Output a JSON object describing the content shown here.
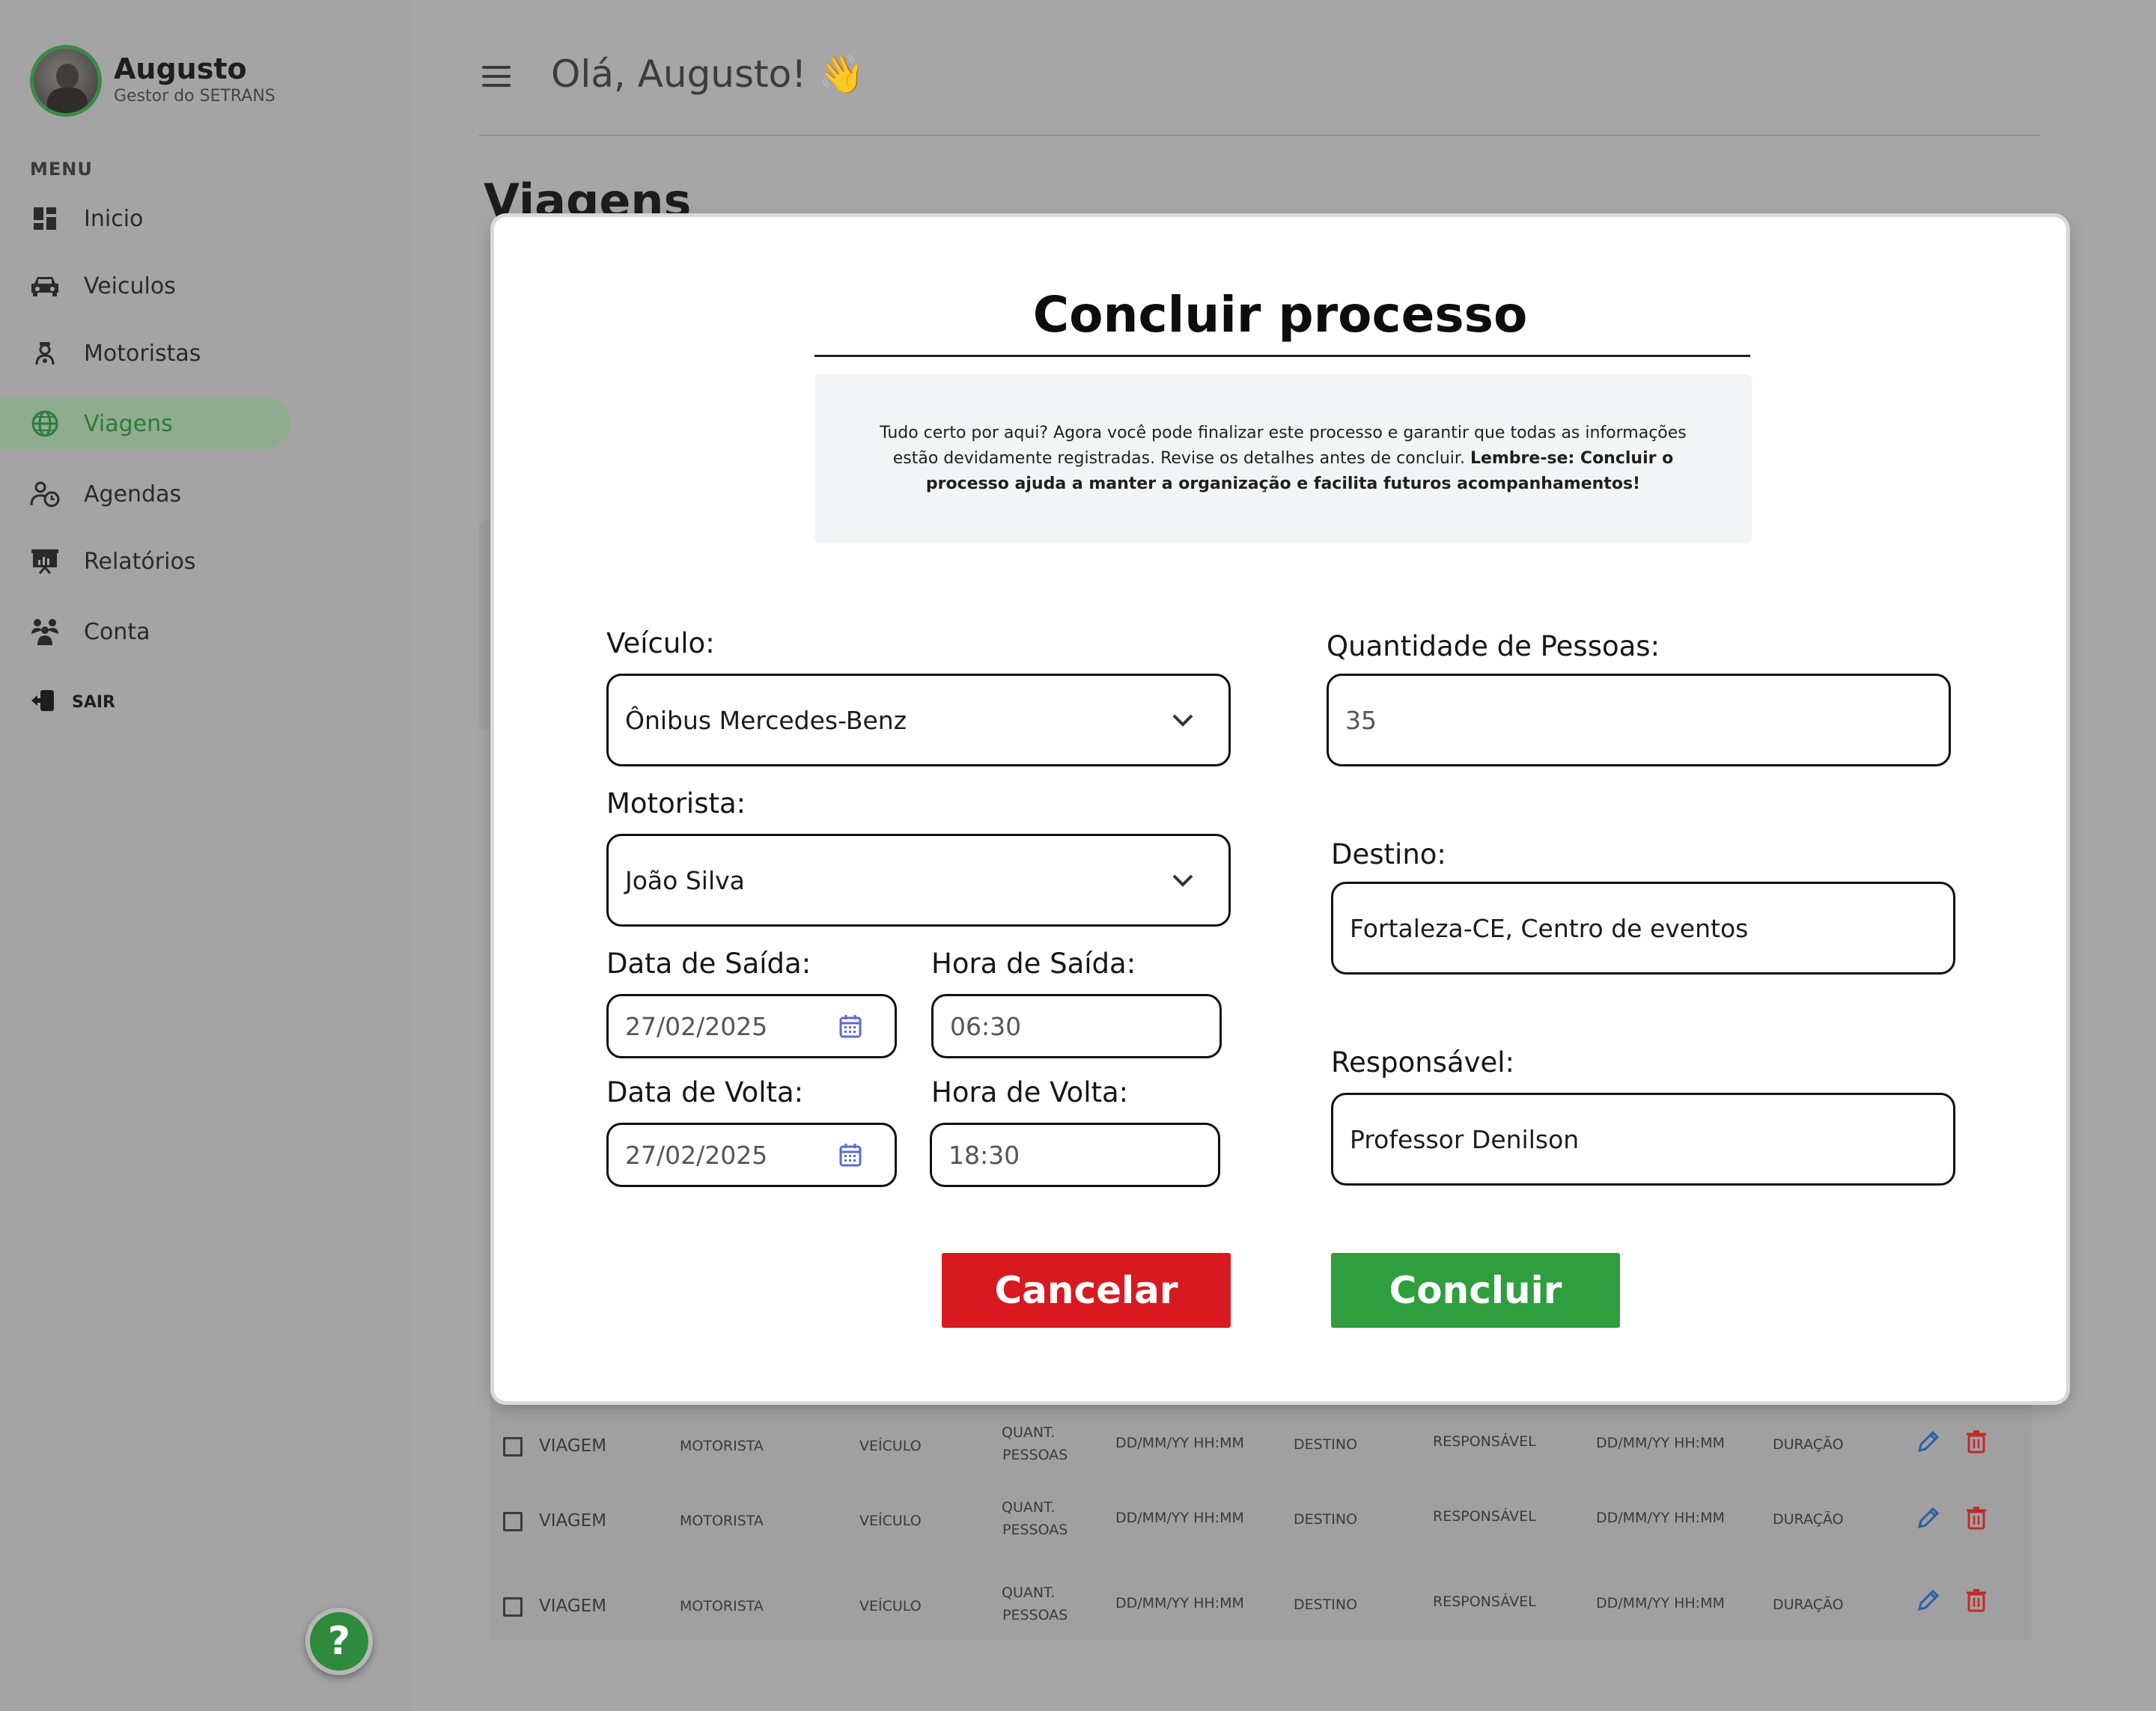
{
  "user": {
    "name": "Augusto",
    "role": "Gestor do SETRANS"
  },
  "sidebar": {
    "menu_label": "MENU",
    "items": [
      {
        "label": "Inicio",
        "icon": "dashboard-icon"
      },
      {
        "label": "Veiculos",
        "icon": "car-icon"
      },
      {
        "label": "Motoristas",
        "icon": "driver-icon"
      },
      {
        "label": "Viagens",
        "icon": "globe-icon",
        "active": true
      },
      {
        "label": "Agendas",
        "icon": "schedule-icon"
      },
      {
        "label": "Relatórios",
        "icon": "report-icon"
      },
      {
        "label": "Conta",
        "icon": "account-icon"
      }
    ],
    "exit_label": "SAIR",
    "help_label": "?"
  },
  "header": {
    "greeting": "Olá, Augusto! 👋"
  },
  "page": {
    "title": "Viagens"
  },
  "table": {
    "rows": [
      {
        "viagem": "VIAGEM",
        "motorista": "MOTORISTA",
        "veiculo": "VEÍCULO",
        "quant": "QUANT.",
        "pessoas": "PESSOAS",
        "saida": "DD/MM/YY HH:MM",
        "destino": "DESTINO",
        "responsavel": "RESPONSÁVEL",
        "volta": "DD/MM/YY HH:MM",
        "duracao": "DURAÇÃO"
      },
      {
        "viagem": "VIAGEM",
        "motorista": "MOTORISTA",
        "veiculo": "VEÍCULO",
        "quant": "QUANT.",
        "pessoas": "PESSOAS",
        "saida": "DD/MM/YY HH:MM",
        "destino": "DESTINO",
        "responsavel": "RESPONSÁVEL",
        "volta": "DD/MM/YY HH:MM",
        "duracao": "DURAÇÃO"
      },
      {
        "viagem": "VIAGEM",
        "motorista": "MOTORISTA",
        "veiculo": "VEÍCULO",
        "quant": "QUANT.",
        "pessoas": "PESSOAS",
        "saida": "DD/MM/YY HH:MM",
        "destino": "DESTINO",
        "responsavel": "RESPONSÁVEL",
        "volta": "DD/MM/YY HH:MM",
        "duracao": "DURAÇÃO"
      }
    ]
  },
  "modal": {
    "title": "Concluir processo",
    "info_text": "Tudo certo por aqui? Agora você pode finalizar este processo e garantir que todas as informações estão devidamente registradas. Revise os detalhes antes de concluir. ",
    "info_bold": "Lembre-se: Concluir o processo ajuda a manter a organização e facilita futuros acompanhamentos!",
    "veiculo": {
      "label": "Veículo:",
      "value": "Ônibus Mercedes-Benz"
    },
    "motorista": {
      "label": "Motorista:",
      "value": "João Silva"
    },
    "data_saida": {
      "label": "Data de Saída:",
      "value": "27/02/2025"
    },
    "hora_saida": {
      "label": "Hora de Saída:",
      "value": "06:30"
    },
    "data_volta": {
      "label": "Data de Volta:",
      "value": "27/02/2025"
    },
    "hora_volta": {
      "label": "Hora de Volta:",
      "value": "18:30"
    },
    "quantidade": {
      "label": "Quantidade de Pessoas:",
      "value": "35"
    },
    "destino": {
      "label": "Destino:",
      "value": "Fortaleza-CE, Centro de eventos"
    },
    "responsavel": {
      "label": "Responsável:",
      "value": "Professor Denilson"
    },
    "cancel_label": "Cancelar",
    "confirm_label": "Concluir"
  },
  "colors": {
    "accent": "#2e9e3f",
    "danger": "#d8191f",
    "sidebar_active": "#2f7a39",
    "edit_icon": "#2f5da8",
    "delete_icon": "#c62828",
    "calendar_icon": "#5b6bd6"
  }
}
